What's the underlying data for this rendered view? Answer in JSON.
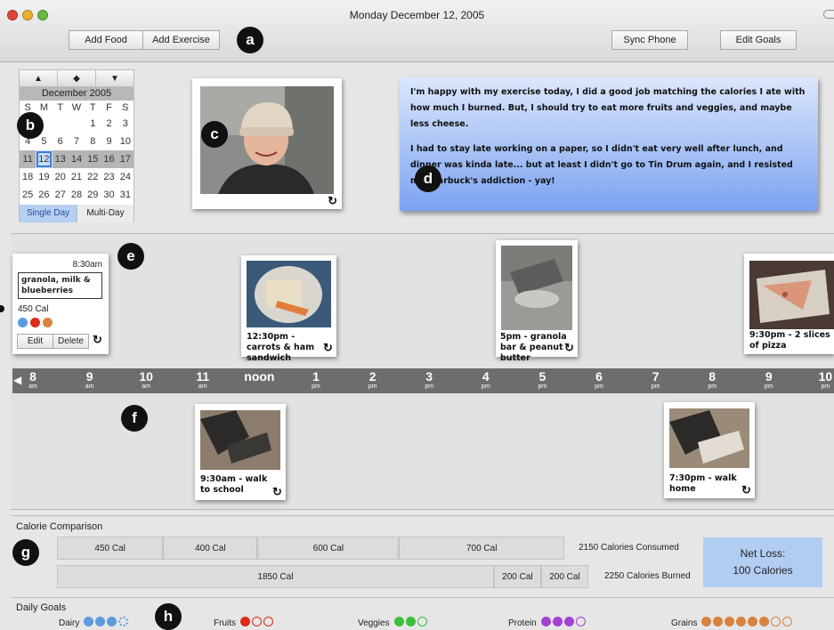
{
  "window": {
    "title": "Monday December 12, 2005"
  },
  "toolbar": {
    "add_food": "Add Food",
    "add_exercise": "Add Exercise",
    "sync_phone": "Sync Phone",
    "edit_goals": "Edit Goals"
  },
  "callouts": {
    "a": "a",
    "b": "b",
    "c": "c",
    "d": "d",
    "e": "e",
    "f": "f",
    "g": "g",
    "h": "h"
  },
  "calendar": {
    "month": "December 2005",
    "weekdays": [
      "S",
      "M",
      "T",
      "W",
      "T",
      "F",
      "S"
    ],
    "weeks": [
      [
        "",
        "",
        "",
        "",
        "1",
        "2",
        "3"
      ],
      [
        "4",
        "5",
        "6",
        "7",
        "8",
        "9",
        "10"
      ],
      [
        "11",
        "12",
        "13",
        "14",
        "15",
        "16",
        "17"
      ],
      [
        "18",
        "19",
        "20",
        "21",
        "22",
        "23",
        "24"
      ],
      [
        "25",
        "26",
        "27",
        "28",
        "29",
        "30",
        "31"
      ]
    ],
    "selected_day": "12",
    "tabs": [
      "Single Day",
      "Multi-Day"
    ],
    "active_tab": "Single Day"
  },
  "journal_note": {
    "paragraph1": "I'm happy with my exercise today, I did a good job matching the calories I ate with how much I burned. But, I should try to eat more fruits and veggies, and maybe less cheese.",
    "paragraph2": "I had to stay late working on a paper, so I didn't eat very well after lunch, and dinner was kinda late... but at least I didn't go to Tin Drum again, and I resisted my Starbuck's addiction - yay!"
  },
  "meal_card": {
    "time": "8:30am",
    "description": "granola, milk & blueberries",
    "calories": "450 Cal",
    "dot_colors": [
      "#5b9be0",
      "#e02a1b",
      "#d9813e"
    ],
    "edit": "Edit",
    "delete": "Delete"
  },
  "food_entries": [
    {
      "caption": "12:30pm - carrots & ham sandwich"
    },
    {
      "caption": "5pm - granola bar & peanut butter"
    },
    {
      "caption": "9:30pm - 2 slices of pizza"
    }
  ],
  "exercise_entries": [
    {
      "caption": "9:30am - walk to school"
    },
    {
      "caption": "7:30pm - walk home"
    }
  ],
  "timeline": {
    "ticks": [
      {
        "hour": "8",
        "period": "am"
      },
      {
        "hour": "9",
        "period": "am"
      },
      {
        "hour": "10",
        "period": "am"
      },
      {
        "hour": "11",
        "period": "am"
      },
      {
        "hour": "noon",
        "period": ""
      },
      {
        "hour": "1",
        "period": "pm"
      },
      {
        "hour": "2",
        "period": "pm"
      },
      {
        "hour": "3",
        "period": "pm"
      },
      {
        "hour": "4",
        "period": "pm"
      },
      {
        "hour": "5",
        "period": "pm"
      },
      {
        "hour": "6",
        "period": "pm"
      },
      {
        "hour": "7",
        "period": "pm"
      },
      {
        "hour": "8",
        "period": "pm"
      },
      {
        "hour": "9",
        "period": "pm"
      },
      {
        "hour": "10",
        "period": "pm"
      }
    ]
  },
  "calorie_comparison": {
    "title": "Calorie Comparison",
    "consumed_segments": [
      "450 Cal",
      "400 Cal",
      "600 Cal",
      "700 Cal"
    ],
    "consumed_values": [
      450,
      400,
      600,
      700
    ],
    "consumed_total": "2150 Calories Consumed",
    "burned_segments": [
      "1850 Cal",
      "200 Cal",
      "200 Cal"
    ],
    "burned_values": [
      1850,
      200,
      200
    ],
    "burned_total": "2250 Calories Burned",
    "net_label": "Net Loss:",
    "net_value": "100 Calories"
  },
  "daily_goals": {
    "title": "Daily Goals",
    "items": [
      {
        "label": "Dairy",
        "color": "#5b9be0",
        "filled": 3,
        "partial": 1,
        "empty": 0
      },
      {
        "label": "Fruits",
        "color": "#e02a1b",
        "filled": 1,
        "partial": 0,
        "empty": 2
      },
      {
        "label": "Veggies",
        "color": "#3cbf3c",
        "filled": 2,
        "partial": 0,
        "empty": 1
      },
      {
        "label": "Protein",
        "color": "#a63fd6",
        "filled": 3,
        "partial": 0,
        "empty": 1
      },
      {
        "label": "Grains",
        "color": "#d9813e",
        "filled": 6,
        "partial": 0,
        "empty": 2
      }
    ]
  }
}
